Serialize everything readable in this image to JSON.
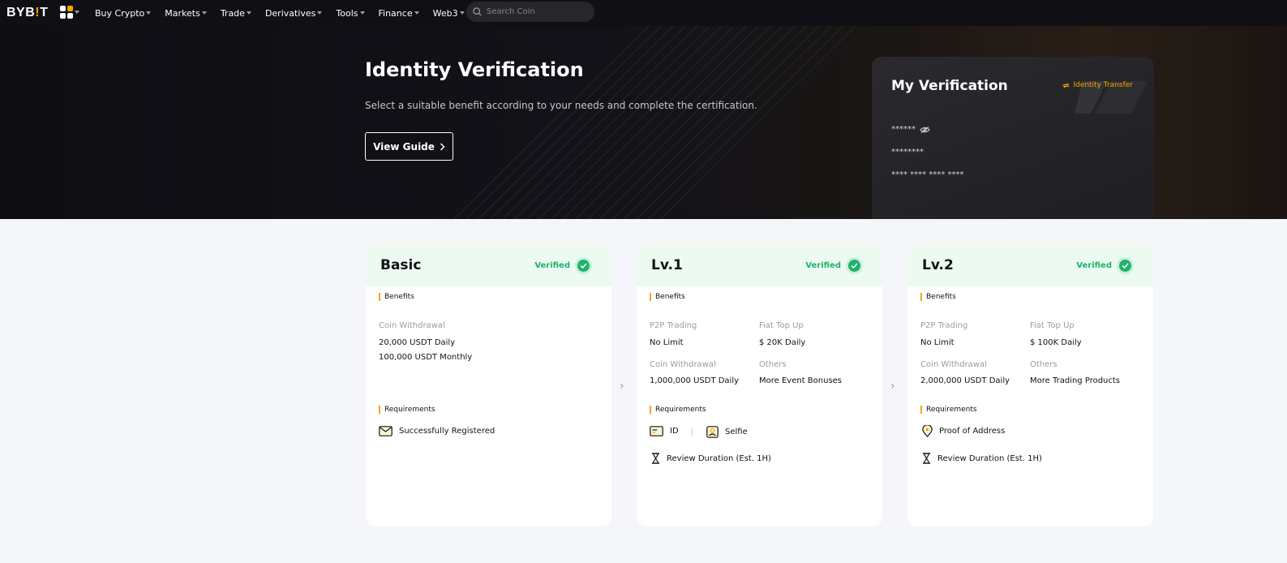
{
  "nav": {
    "logo_pre": "BYB",
    "logo_bang": "!",
    "logo_post": "T",
    "items": [
      "Buy Crypto",
      "Markets",
      "Trade",
      "Derivatives",
      "Tools",
      "Finance",
      "Web3"
    ],
    "search_placeholder": "Search Coin"
  },
  "hero": {
    "title": "Identity Verification",
    "subtitle": "Select a suitable benefit according to your needs and complete the certification.",
    "guide_label": "View Guide",
    "my_title": "My Verification",
    "transfer_label": "Identity Transfer",
    "mask1": "******",
    "mask2": "********",
    "mask3": "**** **** **** ****"
  },
  "colors": {
    "accent": "#f7a600",
    "success": "#20b26c",
    "verified_bg": "#ecfaf2",
    "hero_bg": "#101014"
  },
  "cards": [
    {
      "name": "Basic",
      "status": "Verified",
      "benefits_label": "Benefits",
      "benefits": [
        {
          "label": "Coin Withdrawal",
          "value": "20,000 USDT Daily",
          "value2": "100,000 USDT Monthly"
        }
      ],
      "requirements_label": "Requirements",
      "requirements": [
        "Successfully Registered"
      ]
    },
    {
      "name": "Lv.1",
      "status": "Verified",
      "benefits_label": "Benefits",
      "benefits": [
        {
          "label": "P2P Trading",
          "value": "No Limit"
        },
        {
          "label": "Fiat Top Up",
          "value": "$ 20K Daily"
        },
        {
          "label": "Coin Withdrawal",
          "value": "1,000,000 USDT Daily"
        },
        {
          "label": "Others",
          "value": "More Event Bonuses"
        }
      ],
      "requirements_label": "Requirements",
      "requirements": [
        "ID",
        "Selfie"
      ],
      "review": "Review Duration (Est. 1H)"
    },
    {
      "name": "Lv.2",
      "status": "Verified",
      "benefits_label": "Benefits",
      "benefits": [
        {
          "label": "P2P Trading",
          "value": "No Limit"
        },
        {
          "label": "Fiat Top Up",
          "value": "$ 100K Daily"
        },
        {
          "label": "Coin Withdrawal",
          "value": "2,000,000 USDT Daily"
        },
        {
          "label": "Others",
          "value": "More Trading Products"
        }
      ],
      "requirements_label": "Requirements",
      "requirements": [
        "Proof of Address"
      ],
      "review": "Review Duration (Est. 1H)"
    }
  ],
  "icons": {
    "apps": "apps-grid-icon",
    "search": "search-icon",
    "chevron": "chevron-right-icon",
    "transfer": "swap-icon",
    "eye": "eye-off-icon",
    "check": "check-icon",
    "mail": "mail-icon",
    "id": "id-card-icon",
    "selfie": "selfie-icon",
    "location": "location-pin-icon",
    "hourglass": "hourglass-icon"
  }
}
